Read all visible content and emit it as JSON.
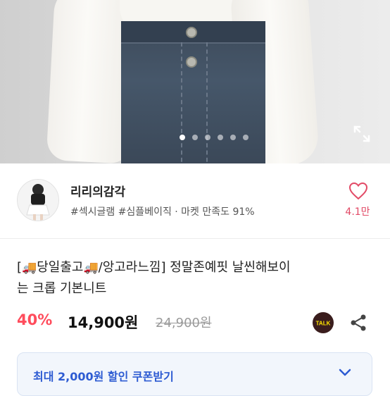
{
  "carousel": {
    "dots": 6,
    "active_index": 0
  },
  "seller": {
    "name": "리리의감각",
    "tags": "#섹시글램 #심플베이직 · 마켓 만족도 91%",
    "likes": "4.1만"
  },
  "product": {
    "title_line1_prefix": "[",
    "title_part1": "당일출고",
    "title_part2": "/앙고라느낌] 정말존예핏 날씬해보이",
    "title_line2": "는 크롭 기본니트",
    "truck_icon": "🚚"
  },
  "price": {
    "discount": "40%",
    "sale": "14,900원",
    "original": "24,900원"
  },
  "talk_badge": "TALK",
  "coupon": {
    "label": "최대 2,000원 할인 쿠폰받기"
  },
  "colors": {
    "accent_red": "#ff4c5c",
    "like_pink": "#e24a66",
    "coupon_blue": "#2d5bd2",
    "talk_yellow": "#3a1d1d"
  }
}
